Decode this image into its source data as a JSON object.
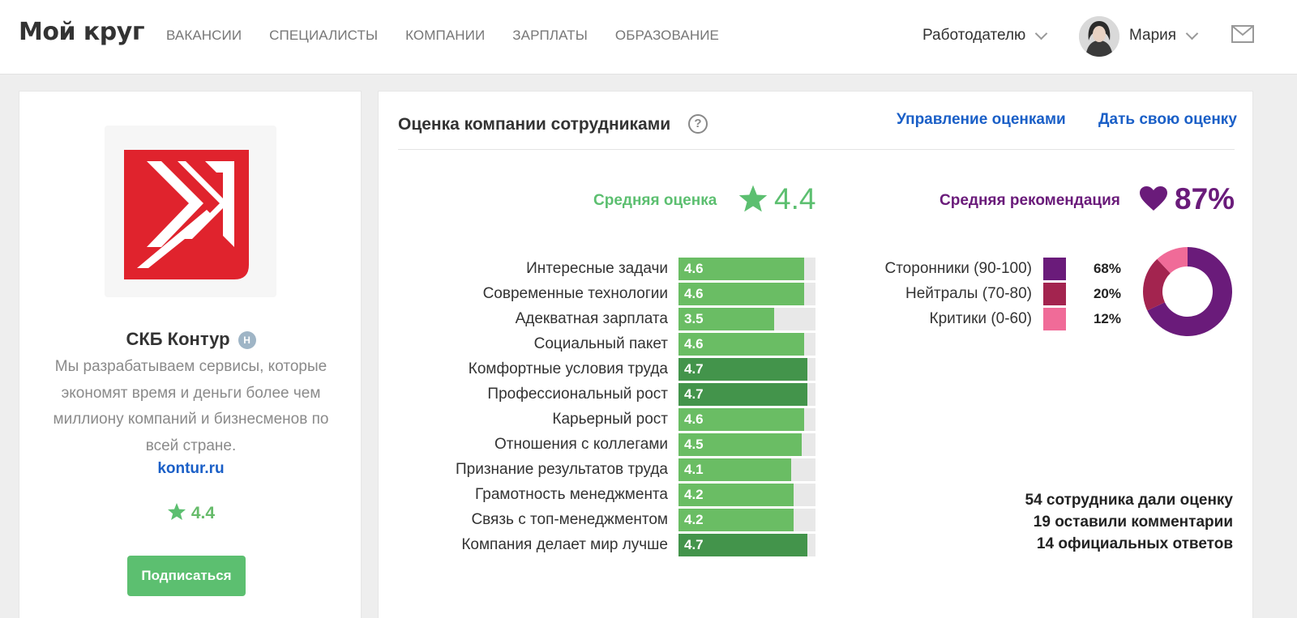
{
  "header": {
    "logo": "Мой круг",
    "nav": [
      "ВАКАНСИИ",
      "СПЕЦИАЛИСТЫ",
      "КОМПАНИИ",
      "ЗАРПЛАТЫ",
      "ОБРАЗОВАНИЕ"
    ],
    "employer": "Работодателю",
    "user": "Мария"
  },
  "company": {
    "name": "СКБ Контур",
    "badge": "H",
    "description": "Мы разрабатываем сервисы, которые экономят время и деньги более чем миллиону компаний и бизнесменов по всей стране.",
    "link": "kontur.ru",
    "rating": "4.4",
    "subscribe": "Подписаться"
  },
  "ratings": {
    "title": "Оценка компании сотрудниками",
    "help": "?",
    "manage_link": "Управление оценками",
    "give_link": "Дать свою оценку",
    "avg_label": "Средняя оценка",
    "avg_value": "4.4",
    "rec_label": "Средняя рекомендация",
    "rec_value": "87%",
    "scale_max": 5,
    "colors": {
      "normal": "#6abd64",
      "high": "#43944b",
      "track": "#e8e8e8"
    },
    "criteria": [
      {
        "label": "Интересные задачи",
        "value": 4.6
      },
      {
        "label": "Современные технологии",
        "value": 4.6
      },
      {
        "label": "Адекватная зарплата",
        "value": 3.5
      },
      {
        "label": "Социальный пакет",
        "value": 4.6
      },
      {
        "label": "Комфортные условия труда",
        "value": 4.7
      },
      {
        "label": "Профессиональный рост",
        "value": 4.7
      },
      {
        "label": "Карьерный рост",
        "value": 4.6
      },
      {
        "label": "Отношения с коллегами",
        "value": 4.5
      },
      {
        "label": "Признание результатов труда",
        "value": 4.1
      },
      {
        "label": "Грамотность менеджмента",
        "value": 4.2
      },
      {
        "label": "Связь с топ-менеджментом",
        "value": 4.2
      },
      {
        "label": "Компания делает мир лучше",
        "value": 4.7
      }
    ],
    "recommendation": [
      {
        "label": "Сторонники (90-100)",
        "pct": "68%",
        "value": 68,
        "color": "#6a1b7a"
      },
      {
        "label": "Нейтралы (70-80)",
        "pct": "20%",
        "value": 20,
        "color": "#a3244f"
      },
      {
        "label": "Критики (0-60)",
        "pct": "12%",
        "value": 12,
        "color": "#f06b98"
      }
    ],
    "stats": [
      "54 сотрудника дали оценку",
      "19 оставили комментарии",
      "14 официальных ответов"
    ]
  }
}
